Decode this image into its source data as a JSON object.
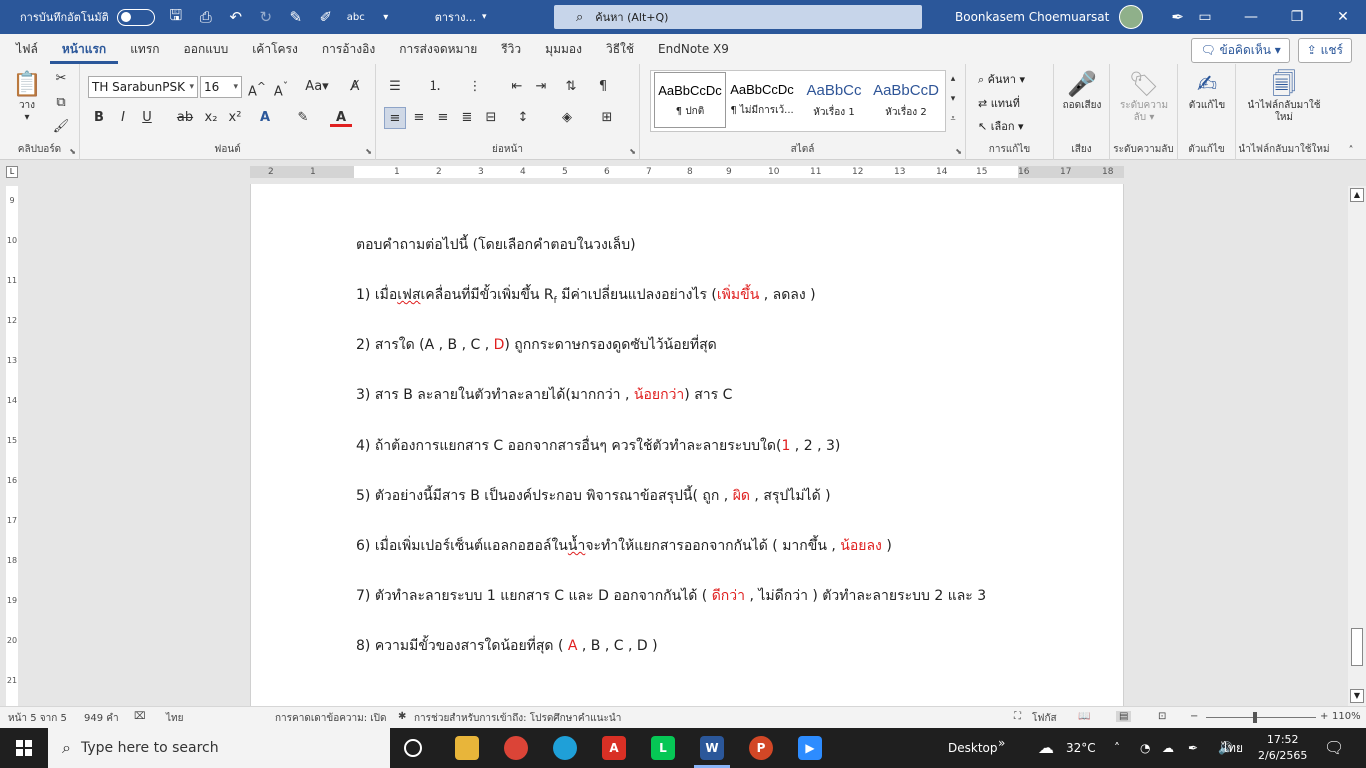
{
  "titlebar": {
    "autosave_label": "การบันทึกอัตโนมัติ",
    "doc_title": "ตาราง...",
    "search_placeholder": "ค้นหา (Alt+Q)",
    "user_name": "Boonkasem Choemuarsat",
    "window_controls": [
      "ribbon-display-icon",
      "minimize-icon",
      "maximize-icon",
      "close-icon"
    ]
  },
  "menu": {
    "tabs": [
      "ไฟล์",
      "หน้าแรก",
      "แทรก",
      "ออกแบบ",
      "เค้าโครง",
      "การอ้างอิง",
      "การส่งจดหมาย",
      "รีวิว",
      "มุมมอง",
      "วิธีใช้",
      "EndNote X9"
    ],
    "active_tab": "หน้าแรก",
    "comments_label": "ข้อคิดเห็น",
    "share_label": "แชร์"
  },
  "ribbon": {
    "clipboard": {
      "paste_label": "วาง",
      "group_label": "คลิปบอร์ด"
    },
    "font": {
      "font_name": "TH SarabunPSK",
      "font_size": "16",
      "group_label": "ฟอนต์"
    },
    "paragraph": {
      "group_label": "ย่อหน้า"
    },
    "styles": {
      "items": [
        {
          "sample": "AaBbCcDc",
          "name": "¶ ปกติ"
        },
        {
          "sample": "AaBbCcDc",
          "name": "¶ ไม่มีการเว้..."
        },
        {
          "sample": "AaBbCc",
          "name": "หัวเรื่อง 1"
        },
        {
          "sample": "AaBbCcD",
          "name": "หัวเรื่อง 2"
        }
      ],
      "group_label": "สไตล์"
    },
    "editing": {
      "find": "ค้นหา",
      "replace": "แทนที่",
      "select": "เลือก",
      "group_label": "การแก้ไข"
    },
    "voice": {
      "dictate": "ถอดเสียง",
      "group_label": "เสียง"
    },
    "sensitivity": {
      "label": "ระดับความลับ",
      "group_label": "ระดับความลับ"
    },
    "editor": {
      "label": "ตัวแก้ไข",
      "group_label": "ตัวแก้ไข"
    },
    "reuse": {
      "label": "นำไฟล์กลับมาใช้ใหม่",
      "group_label": "นำไฟล์กลับมาใช้ใหม่"
    }
  },
  "ruler": {
    "numbers": [
      "2",
      "1",
      "1",
      "2",
      "3",
      "4",
      "5",
      "6",
      "7",
      "8",
      "9",
      "10",
      "11",
      "12",
      "13",
      "14",
      "15",
      "16",
      "17",
      "18"
    ],
    "vertical_numbers": [
      "9",
      "10",
      "11",
      "12",
      "13",
      "14",
      "15",
      "16",
      "17",
      "18",
      "19",
      "20",
      "21"
    ]
  },
  "document": {
    "intro": "ตอบคำถามต่อไปนี้ (โดยเลือกคำตอบในวงเล็บ)",
    "q1": {
      "pre": "1) เมื่อ",
      "squig": "เฟส",
      "mid": "เคลื่อนที่มีขั้วเพิ่มขึ้น R",
      "sub": "f",
      "post": " มีค่าเปลี่ยนแปลงอย่างไร (",
      "ans": "เพิ่มขึ้น",
      "end": " , ลดลง )"
    },
    "q2": {
      "pre": "2) สารใด (A , B , C , ",
      "ans": "D",
      "end": ") ถูกกระดาษกรองดูดซับไว้น้อยที่สุด"
    },
    "q3": {
      "pre": "3) สาร B ละลายในตัวทำละลายได้(มากกว่า , ",
      "ans": "น้อยกว่า",
      "end": ") สาร C"
    },
    "q4": {
      "pre": "4) ถ้าต้องการแยกสาร C ออกจากสารอื่นๆ ควรใช้ตัวทำละลายระบบใด(",
      "ans": "1",
      "end": " , 2 , 3)"
    },
    "q5": {
      "pre": "5) ตัวอย่างนี้มีสาร B เป็นองค์ประกอบ พิจารณาข้อสรุปนี้( ถูก , ",
      "ans": "ผิด",
      "end": " , สรุปไม่ได้ )"
    },
    "q6": {
      "pre": "6) เมื่อเพิ่มเปอร์เซ็นต์แอลกอฮอล์ใน",
      "squig": "น้ำ",
      "mid": "จะทำให้แยกสารออกจากกันได้ ( มากขึ้น , ",
      "ans": "น้อยลง",
      "end": " )"
    },
    "q7": {
      "pre": "7) ตัวทำละลายระบบ 1 แยกสาร C และ D ออกจากกันได้ ( ",
      "ans": "ดีกว่า",
      "end": " , ไม่ดีกว่า ) ตัวทำละลายระบบ 2 และ 3"
    },
    "q8": {
      "pre": "8) ความมีขั้วของสารใดน้อยที่สุด ( ",
      "ans": "A",
      "end": " , B , C , D )"
    }
  },
  "statusbar": {
    "page": "หน้า 5 จาก 5",
    "words": "949 คำ",
    "language": "ไทย",
    "text_prediction": "การคาดเดาข้อความ: เปิด",
    "accessibility": "การช่วยสำหรับการเข้าถึง: โปรดศึกษาคำแนะนำ",
    "focus": "โฟกัส",
    "zoom": "110%"
  },
  "taskbar": {
    "search_placeholder": "Type here to search",
    "desktop_label": "Desktop",
    "temperature": "32°C",
    "language": "ไทย",
    "time": "17:52",
    "date": "2/6/2565"
  },
  "colors": {
    "accent": "#2b579a",
    "answer_red": "#e02020"
  }
}
